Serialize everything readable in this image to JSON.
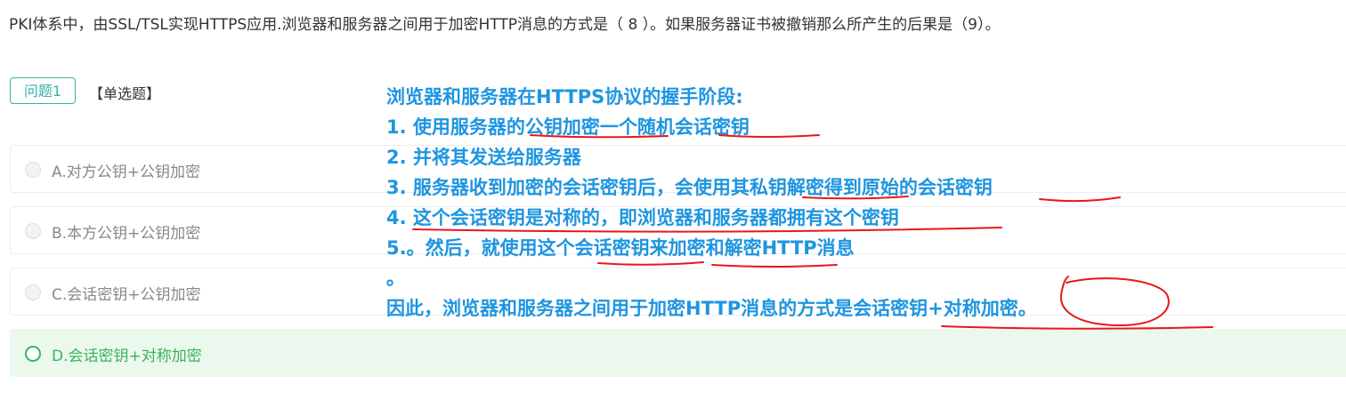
{
  "question": {
    "text": "PKI体系中，由SSL/TSL实现HTTPS应用.浏览器和服务器之间用于加密HTTP消息的方式是（ 8 ）。如果服务器证书被撤销那么所产生的后果是（9）。"
  },
  "question_badge": "问题1",
  "question_type": "【单选题】",
  "options": [
    {
      "label": "A.对方公钥+公钥加密"
    },
    {
      "label": "B.本方公钥+公钥加密"
    },
    {
      "label": "C.会话密钥+公钥加密"
    },
    {
      "label": "D.会话密钥+对称加密",
      "correct": true
    }
  ],
  "annotation": {
    "lines": [
      "浏览器和服务器在HTTPS协议的握手阶段:",
      "1. 使用服务器的公钥加密一个随机会话密钥",
      "2. 并将其发送给服务器",
      "3. 服务器收到加密的会话密钥后，会使用其私钥解密得到原始的会话密钥",
      "4. 这个会话密钥是对称的，即浏览器和服务器都拥有这个密钥",
      "5.。然后，就使用这个会话密钥来加密和解密HTTP消息",
      "。",
      "因此，浏览器和服务器之间用于加密HTTP消息的方式是会话密钥+对称加密。"
    ],
    "text_color": "#1e95e0",
    "ink_color": "#e8171b"
  },
  "colors": {
    "badge": "#39b0a4",
    "correct": "#3cb25c",
    "correct_bg": "#eaf8ee"
  }
}
